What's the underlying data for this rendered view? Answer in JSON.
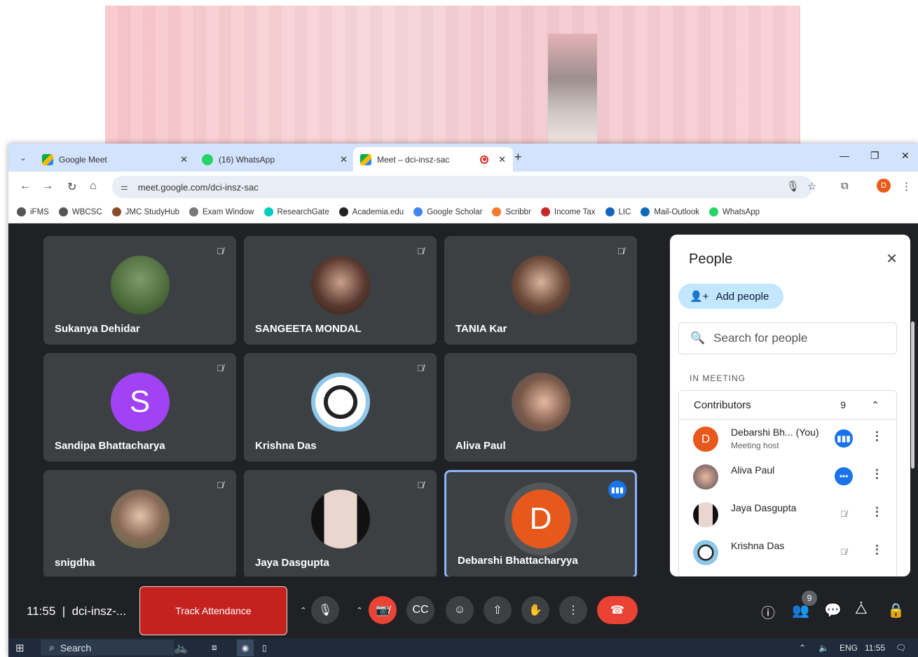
{
  "browser": {
    "tabs": [
      {
        "label": "Google Meet",
        "icon": "meet-icon"
      },
      {
        "label": "(16) WhatsApp",
        "icon": "whatsapp-icon"
      },
      {
        "label": "Meet – dci-insz-sac",
        "icon": "meet-icon",
        "recording": true
      }
    ],
    "new_tab": "+",
    "url": "meet.google.com/dci-insz-sac",
    "profile_initial": "D"
  },
  "bookmarks": [
    {
      "label": "iFMS",
      "color": "#555555"
    },
    {
      "label": "WBCSC",
      "color": "#555555"
    },
    {
      "label": "JMC StudyHub",
      "color": "#8a4b2b"
    },
    {
      "label": "Exam Window",
      "color": "#777777"
    },
    {
      "label": "ResearchGate",
      "color": "#00ccbb"
    },
    {
      "label": "Academia.edu",
      "color": "#222222"
    },
    {
      "label": "Google Scholar",
      "color": "#4285f4"
    },
    {
      "label": "Scribbr",
      "color": "#f4792b"
    },
    {
      "label": "Income Tax",
      "color": "#c62828"
    },
    {
      "label": "LIC",
      "color": "#1565c0"
    },
    {
      "label": "Mail-Outlook",
      "color": "#0f6cbd"
    },
    {
      "label": "WhatsApp",
      "color": "#25d366"
    }
  ],
  "tiles": [
    {
      "name": "Sukanya Dehidar",
      "muted": true
    },
    {
      "name": "SANGEETA MONDAL",
      "muted": true
    },
    {
      "name": "TANIA Kar",
      "muted": true
    },
    {
      "name": "Sandipa Bhattacharya",
      "muted": true,
      "initial": "S",
      "avatar_color": "#a142f4"
    },
    {
      "name": "Krishna Das",
      "muted": true
    },
    {
      "name": "Aliva Paul",
      "muted": false
    },
    {
      "name": "snigdha",
      "muted": true
    },
    {
      "name": "Jaya Dasgupta",
      "muted": true
    },
    {
      "name": "Debarshi Bhattacharyya",
      "muted": false,
      "initial": "D",
      "avatar_color": "#e8581c",
      "speaking": true
    }
  ],
  "people_panel": {
    "title": "People",
    "add_people": "Add people",
    "search_placeholder": "Search for people",
    "section": "IN MEETING",
    "group_label": "Contributors",
    "group_count": "9",
    "participants": [
      {
        "name": "Debarshi Bh...  (You)",
        "role": "Meeting host",
        "initial": "D",
        "status": "speaking"
      },
      {
        "name": "Aliva Paul",
        "role": "",
        "status": "more"
      },
      {
        "name": "Jaya Dasgupta",
        "role": "",
        "status": "muted"
      },
      {
        "name": "Krishna Das",
        "role": "",
        "status": "muted"
      }
    ]
  },
  "controls": {
    "time": "11:55",
    "meeting_code": "dci-insz-...",
    "track_attendance": "Track Attendance",
    "people_count": "9"
  },
  "taskbar": {
    "search": "Search",
    "language": "ENG",
    "time": "11:55"
  }
}
